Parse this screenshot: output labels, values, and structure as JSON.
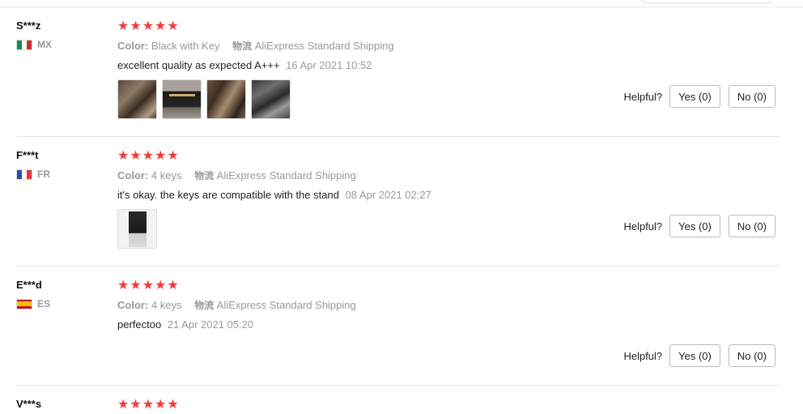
{
  "helpful_label": "Helpful?",
  "ship_label": "物流",
  "star_glyph": "★",
  "reviews": [
    {
      "user": "S***z",
      "country": "MX",
      "rating": 5,
      "attr_label": "Color:",
      "attr_value": "Black with Key",
      "shipping": "AliExpress Standard Shipping",
      "text": "excellent quality as expected A+++",
      "date": "16 Apr 2021 10:52",
      "photo_count": 4,
      "yes": "Yes (0)",
      "no": "No (0)"
    },
    {
      "user": "F***t",
      "country": "FR",
      "rating": 5,
      "attr_label": "Color:",
      "attr_value": "4 keys",
      "shipping": "AliExpress Standard Shipping",
      "text": "it's okay. the keys are compatible with the stand",
      "date": "08 Apr 2021 02:27",
      "photo_count": 1,
      "yes": "Yes (0)",
      "no": "No (0)"
    },
    {
      "user": "E***d",
      "country": "ES",
      "rating": 5,
      "attr_label": "Color:",
      "attr_value": "4 keys",
      "shipping": "AliExpress Standard Shipping",
      "text": "perfectoo",
      "date": "21 Apr 2021 05:20",
      "photo_count": 0,
      "yes": "Yes (0)",
      "no": "No (0)"
    },
    {
      "user": "V***s",
      "rating": 5
    }
  ]
}
